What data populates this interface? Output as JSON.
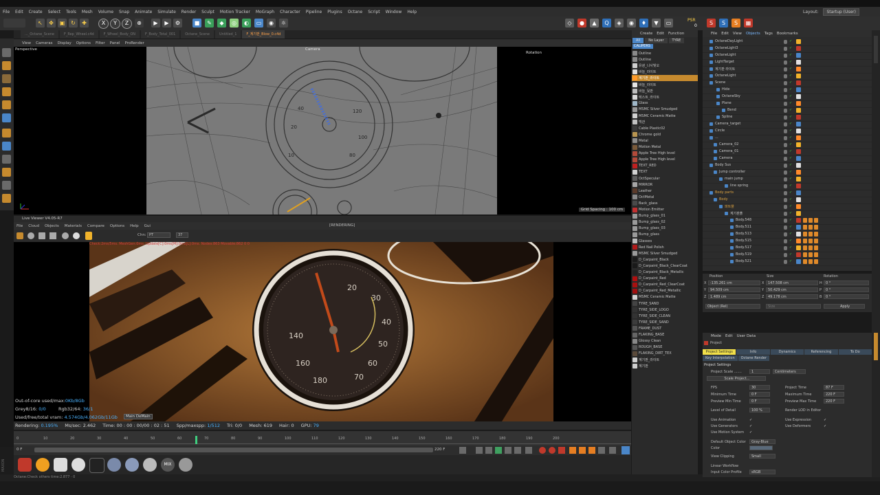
{
  "menu": [
    "File",
    "Edit",
    "Create",
    "Select",
    "Tools",
    "Mesh",
    "Volume",
    "Snap",
    "Animate",
    "Simulate",
    "Render",
    "Sculpt",
    "Motion Tracker",
    "MoGraph",
    "Character",
    "Pipeline",
    "Plugins",
    "Octane",
    "Script",
    "Window",
    "Help"
  ],
  "layout": {
    "label": "Layout:",
    "value": "Startup (User)"
  },
  "toolbar": {
    "axis_x": "X",
    "axis_y": "Y",
    "axis_z": "Z",
    "psr": "PSR",
    "psr_count": "0"
  },
  "doc_tabs": [
    "..._Octane_Scene",
    "F_Rep_Wheel.c4d",
    "F_Wheel_Body_ON",
    "F_Body_Total_001",
    "Octane_Scene",
    "Untitled_1",
    "F_계기판_Blow_0.c4d"
  ],
  "viewport": {
    "menu": [
      "View",
      "Cameras",
      "Display",
      "Options",
      "Filter",
      "Panel",
      "ProRender"
    ],
    "label": "Perspective",
    "camera": "Camera",
    "rotation": "Rotation",
    "grid_spacing": "Grid Spacing : 100 cm"
  },
  "live_viewer": {
    "title": "Live Viewer V4.05-R7",
    "status": "[RENDERING]",
    "menu": [
      "File",
      "Cloud",
      "Objects",
      "Materials",
      "Compare",
      "Options",
      "Help",
      "Gui"
    ],
    "channel": "Chn:",
    "channel_value": "PT",
    "value_37": "37"
  },
  "overlay_text": "Check:2ms/5ms. MeshGen:0ms. Update[C]:0ms[M]:0ms[L]:0ms. Nodes:863 Movable:862 0 0",
  "render_stats": {
    "out_of_core_label": "Out-of-core used/max:",
    "out_of_core_value": "0Kb/8Gb",
    "grey_label": "Grey8/16:",
    "grey_value": "0/0",
    "rgb_label": "Rgb32/64:",
    "rgb_value": "36/1",
    "vram_label": "Used/free/total vram:",
    "vram_value": "4.574Gb/4.062Gb/11Gb",
    "tooltip": "Main DeMain"
  },
  "status": {
    "rendering_label": "Rendering:",
    "rendering_value": "0.195%",
    "mssec_label": "Ms/sec:",
    "mssec_value": "2.462",
    "time_label": "Time:",
    "time_value": "00 : 00 : 00/00 : 02 : 51",
    "spp_label": "Spp/maxspp:",
    "spp_value": "1/512",
    "tri_label": "Tri:",
    "tri_value": "0/0",
    "mesh_label": "Mesh:",
    "mesh_value": "619",
    "hair_label": "Hair:",
    "hair_value": "0",
    "gpu_label": "GPU:",
    "gpu_value": "79"
  },
  "timeline": {
    "ticks": [
      "0",
      "10",
      "20",
      "30",
      "40",
      "50",
      "60",
      "70",
      "80",
      "90",
      "100",
      "110",
      "120",
      "130",
      "140",
      "150",
      "160",
      "170",
      "180",
      "190",
      "200"
    ],
    "current": "0 F",
    "end": "220 F"
  },
  "bottom": {
    "mix": "MIX",
    "status_text": "Octane:Check others time:2.877 · 0"
  },
  "materials": {
    "menu": [
      "Create",
      "Edit",
      "Function"
    ],
    "filters": [
      "All",
      "No Layer",
      "TYRE"
    ],
    "header": "CALIPERS",
    "items": [
      {
        "name": "Outline",
        "color": "#8a8a8a"
      },
      {
        "name": "Outline",
        "color": "#8a8a8a"
      },
      {
        "name": "유광_나사빛오",
        "color": "#cfcfcf"
      },
      {
        "name": "바늘_라이트",
        "color": "#e0e0e0"
      },
      {
        "name": "계기판_라이트",
        "color": "#ff9a2a"
      },
      {
        "name": "바늘_라이트",
        "color": "#e6e6e6"
      },
      {
        "name": "바늘_뒷판",
        "color": "#bdbdbd"
      },
      {
        "name": "렉스트_라이트",
        "color": "#d8d8d8"
      },
      {
        "name": "Glass",
        "color": "#9fb7c8"
      },
      {
        "name": "MSMC Silver Smudged",
        "color": "#9a9a9a"
      },
      {
        "name": "MSMC Ceramic Matte",
        "color": "#d2d2d2"
      },
      {
        "name": "백관",
        "color": "#c0c0c0"
      },
      {
        "name": "Cable Plastic02",
        "color": "#3a3a3a"
      },
      {
        "name": "Chrome gold",
        "color": "#b89550"
      },
      {
        "name": "Metal",
        "color": "#8e8e8e"
      },
      {
        "name": "Motion Metal",
        "color": "#7a5a3a"
      },
      {
        "name": "Apple Tree High level",
        "color": "#b34a3a"
      },
      {
        "name": "Apple Tree High level",
        "color": "#b34a3a"
      },
      {
        "name": "TEXT_RED",
        "color": "#c02020"
      },
      {
        "name": "TEXT",
        "color": "#d0d0d0"
      },
      {
        "name": "OctSpecular",
        "color": "#5e5e5e"
      },
      {
        "name": "MIRROR",
        "color": "#a6a6a6"
      },
      {
        "name": "Leather",
        "color": "#5a3a2a"
      },
      {
        "name": "OctMetal",
        "color": "#8a8a8a"
      },
      {
        "name": "Back_glass",
        "color": "#4a4a4a"
      },
      {
        "name": "Motion Emitter",
        "color": "#c23030"
      },
      {
        "name": "Bump_glass_01",
        "color": "#9a9a9a"
      },
      {
        "name": "Bump_glass_02",
        "color": "#9a9a9a"
      },
      {
        "name": "Bump_glass_03",
        "color": "#9a9a9a"
      },
      {
        "name": "Bump_glass",
        "color": "#9a9a9a"
      },
      {
        "name": "Glasses",
        "color": "#bcbcbc"
      },
      {
        "name": "Red Nail Polish",
        "color": "#b01a1a"
      },
      {
        "name": "MSMC Silver Smudged",
        "color": "#9a9a9a"
      },
      {
        "name": "D_Carpaint_Black",
        "color": "#1a1a1a"
      },
      {
        "name": "D_Carpaint_Black_ClearCoat",
        "color": "#1a1a1a"
      },
      {
        "name": "D_Carpaint_Black_Metallic",
        "color": "#222"
      },
      {
        "name": "D_Carpaint_Red",
        "color": "#b01010"
      },
      {
        "name": "D_Carpaint_Red_ClearCoat",
        "color": "#a81010"
      },
      {
        "name": "D_Carpaint_Red_Metallic",
        "color": "#a01010"
      },
      {
        "name": "MSMC Ceramic Matte",
        "color": "#d2d2d2"
      },
      {
        "name": "TYRE_SAND",
        "color": "#444"
      },
      {
        "name": "TYRE_SIDE_LOGO",
        "color": "#333"
      },
      {
        "name": "TYRE_SIDE_CLEAN",
        "color": "#333"
      },
      {
        "name": "TYRE_SIDE_SAND",
        "color": "#3c3c3c"
      },
      {
        "name": "FRAME_DUST",
        "color": "#555"
      },
      {
        "name": "FLAKING_BASE",
        "color": "#666"
      },
      {
        "name": "Glossy Clean",
        "color": "#888"
      },
      {
        "name": "ROUGH_BASE",
        "color": "#555"
      },
      {
        "name": "FLAKING_DIRT_TEX",
        "color": "#5a4a3a"
      },
      {
        "name": "계기판_라이트",
        "color": "#cfcfcf"
      },
      {
        "name": "계기판",
        "color": "#cfcfcf"
      }
    ]
  },
  "objects": {
    "menu": [
      "File",
      "Edit",
      "View",
      "Objects",
      "Tags",
      "Bookmarks"
    ],
    "items": [
      {
        "name": "OctaneDayLight",
        "indent": 10
      },
      {
        "name": "OctaneLight3",
        "indent": 10
      },
      {
        "name": "OctaneLight",
        "indent": 10
      },
      {
        "name": "LightTarget",
        "indent": 10
      },
      {
        "name": "계기판 라이트",
        "indent": 10
      },
      {
        "name": "OctaneLight",
        "indent": 10
      },
      {
        "name": "Scene",
        "indent": 10
      },
      {
        "name": "Hide",
        "indent": 20
      },
      {
        "name": "OctaneSky",
        "indent": 20
      },
      {
        "name": "Plane",
        "indent": 20
      },
      {
        "name": "Bend",
        "indent": 28
      },
      {
        "name": "Spline",
        "indent": 20
      },
      {
        "name": "Camera_target",
        "indent": 10
      },
      {
        "name": "Circle",
        "indent": 10
      },
      {
        "name": "...",
        "indent": 10
      },
      {
        "name": "Camera_02",
        "indent": 16
      },
      {
        "name": "Camera_01",
        "indent": 16
      },
      {
        "name": "Camera",
        "indent": 16
      },
      {
        "name": "Body Sus",
        "indent": 10
      },
      {
        "name": "Jump controller",
        "indent": 16
      },
      {
        "name": "main jump",
        "indent": 24
      },
      {
        "name": "line spring",
        "indent": 32
      },
      {
        "name": "Body parts",
        "indent": 10
      },
      {
        "name": "Body",
        "indent": 16
      },
      {
        "name": "파트폴",
        "indent": 24
      },
      {
        "name": "계기판폴",
        "indent": 32
      },
      {
        "name": "Body.548",
        "indent": 40
      },
      {
        "name": "Body.511",
        "indent": 40
      },
      {
        "name": "Body.513",
        "indent": 40
      },
      {
        "name": "Body.515",
        "indent": 40
      },
      {
        "name": "Body.517",
        "indent": 40
      },
      {
        "name": "Body.519",
        "indent": 40
      },
      {
        "name": "Body.521",
        "indent": 40
      }
    ]
  },
  "coordinates": {
    "headers": [
      "Position",
      "Size",
      "Rotation"
    ],
    "rows": [
      {
        "axis": "X",
        "pos": "-135.261 cm",
        "size": "147.508 cm",
        "rot_axis": "H",
        "rot": "0 °"
      },
      {
        "axis": "Y",
        "pos": "94.509 cm",
        "size": "50.429 cm",
        "rot_axis": "P",
        "rot": "0 °"
      },
      {
        "axis": "Z",
        "pos": "1.489 cm",
        "size": "49.178 cm",
        "rot_axis": "B",
        "rot": "0 °"
      }
    ],
    "mode": "Object (Rel)",
    "size_mode": "Size",
    "apply": "Apply"
  },
  "attributes": {
    "menu": [
      "Mode",
      "Edit",
      "User Data"
    ],
    "title": "Project",
    "tabs": [
      "Project Settings",
      "Info",
      "Dynamics",
      "Referencing",
      "To Do"
    ],
    "tabs2": [
      "Key Interpolation",
      "Octane Render"
    ],
    "section": "Project Settings",
    "project_scale_label": "Project Scale .......",
    "project_scale_value": "1",
    "project_scale_unit": "Centimeters",
    "scale_project": "Scale Project...",
    "fields": [
      {
        "l": "FPS",
        "v": "30",
        "l2": "Project Time",
        "v2": "87 F"
      },
      {
        "l": "Minimum Time",
        "v": "0 F",
        "l2": "Maximum Time",
        "v2": "220 F"
      },
      {
        "l": "Preview Min Time",
        "v": "0 F",
        "l2": "Preview Max Time",
        "v2": "220 F"
      }
    ],
    "lod_label": "Level of Detail",
    "lod_value": "100 %",
    "render_lod": "Render LOD in Editor",
    "checks": [
      "Use Animation",
      "Use Generators",
      "Use Motion System"
    ],
    "checks2": [
      "Use Expression",
      "Use Deformers"
    ],
    "default_color_label": "Default Object Color",
    "default_color_value": "Gray-Blue",
    "color_label": "Color",
    "view_clipping_label": "View Clipping",
    "view_clipping_value": "Small",
    "linear_workflow": "Linear Workflow",
    "input_color_label": "Input Color Profile",
    "input_color_value": "sRGB",
    "use_color_channel": "Use Color Channel for Node Material"
  }
}
